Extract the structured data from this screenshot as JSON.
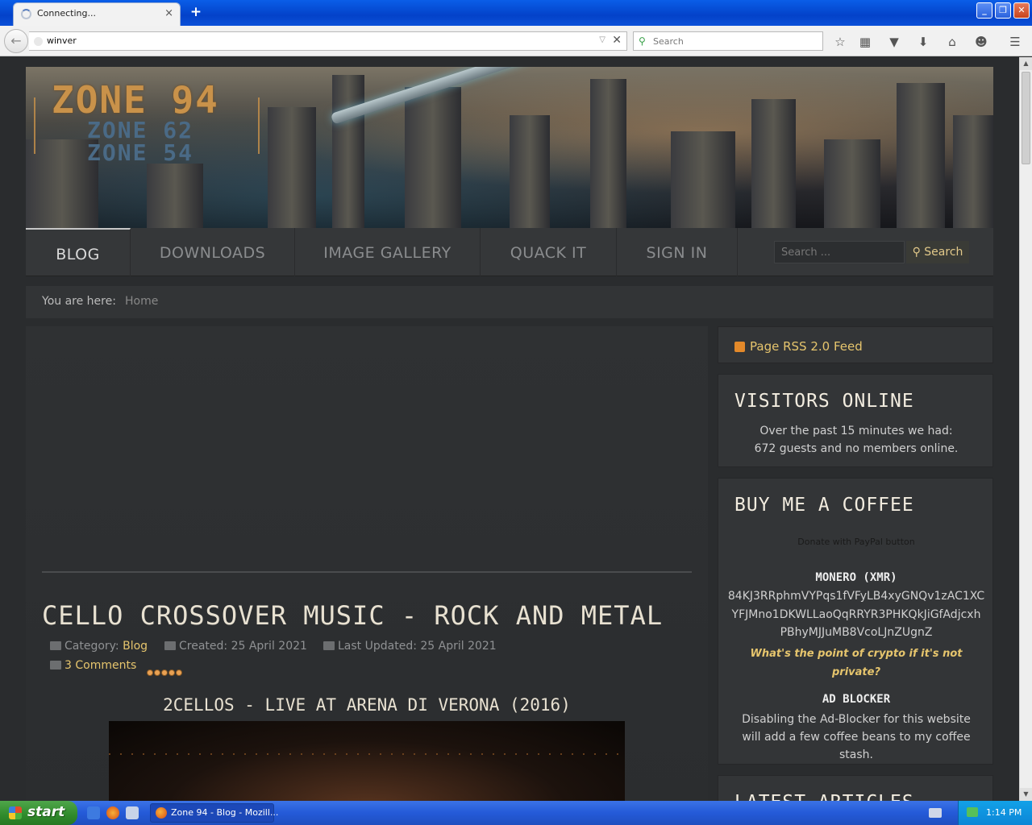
{
  "browser": {
    "tab_title": "Connecting...",
    "tab_close": "×",
    "new_tab": "+",
    "url": "winver",
    "search_placeholder": "Search",
    "window_buttons": {
      "minimize": "_",
      "maximize": "❐",
      "close": "✕"
    },
    "toolbar_icons": [
      "star-icon",
      "reading-list-icon",
      "pocket-icon",
      "download-icon",
      "home-icon",
      "chat-icon",
      "menu-icon"
    ]
  },
  "site": {
    "logo": {
      "main": "ZONE 94",
      "sub1": "ZONE 62",
      "sub2": "ZONE 54"
    },
    "nav": {
      "items": [
        {
          "label": "BLOG",
          "active": true
        },
        {
          "label": "DOWNLOADS",
          "active": false
        },
        {
          "label": "IMAGE GALLERY",
          "active": false
        },
        {
          "label": "QUACK IT",
          "active": false
        },
        {
          "label": "SIGN IN",
          "active": false
        }
      ],
      "search_placeholder": "Search ...",
      "search_button": "Search"
    },
    "breadcrumb": {
      "label": "You are here:",
      "home": "Home"
    }
  },
  "article": {
    "title": "CELLO CROSSOVER MUSIC - ROCK AND METAL",
    "category_label": "Category:",
    "category": "Blog",
    "created": "Created: 25 April 2021",
    "updated": "Last Updated: 25 April 2021",
    "comments": "3 Comments",
    "rating": 5,
    "video_title": "2CELLOS - LIVE AT ARENA DI VERONA (2016)"
  },
  "sidebar": {
    "rss": "Page RSS 2.0 Feed",
    "visitors": {
      "title": "VISITORS ONLINE",
      "line1": "Over the past 15 minutes we had:",
      "line2": "672 guests and no members online."
    },
    "coffee": {
      "title": "BUY ME A COFFEE",
      "paypal_alt": "Donate with PayPal button",
      "monero_title": "MONERO (XMR)",
      "address_lines": [
        "84KJ3RRphmVYPqs1fVFyLB4xyGNQv1zAC1XC",
        "YFJMno1DKWLLaoQqRRYR3PHKQkJiGfAdjcxh",
        "PBhyMJJuMB8VcoLJnZUgnZ"
      ],
      "quote": "What's the point of crypto if it's not private?",
      "adblock_title": "AD BLOCKER",
      "adblock_text": "Disabling the Ad-Blocker for this website will add a few coffee beans to my coffee stash."
    },
    "latest_title": "LATEST ARTICLES"
  },
  "taskbar": {
    "start": "start",
    "task_label": "Zone 94 - Blog - Mozill...",
    "clock": "1:14 PM"
  },
  "colors": {
    "accent_gold": "#e6c56d",
    "titlebar_blue": "#0342c9",
    "start_green": "#2f8a2b"
  }
}
